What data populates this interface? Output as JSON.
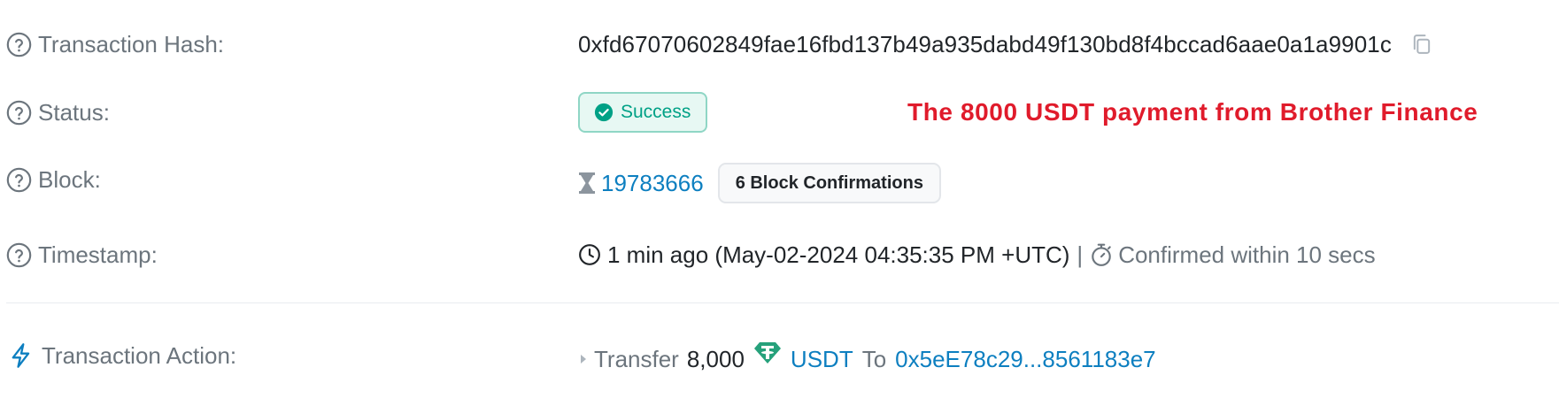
{
  "rows": {
    "tx_hash": {
      "label": "Transaction Hash:",
      "value": "0xfd67070602849fae16fbd137b49a935dabd49f130bd8f4bccad6aae0a1a9901c"
    },
    "status": {
      "label": "Status:",
      "badge": "Success",
      "note": "The 8000 USDT payment from Brother Finance"
    },
    "block": {
      "label": "Block:",
      "number": "19783666",
      "confirmations": "6 Block Confirmations"
    },
    "timestamp": {
      "label": "Timestamp:",
      "value": "1 min ago (May-02-2024 04:35:35 PM +UTC)",
      "separator": "|",
      "confirmed": "Confirmed within 10 secs"
    },
    "action": {
      "label": "Transaction Action:",
      "verb": "Transfer",
      "amount": "8,000",
      "token": "USDT",
      "to_word": "To",
      "to_address": "0x5eE78c29...8561183e7"
    }
  },
  "icons": {
    "help": "question-circle-icon",
    "copy": "copy-icon",
    "success": "check-circle-icon",
    "hourglass": "hourglass-icon",
    "clock": "clock-icon",
    "stopwatch": "stopwatch-icon",
    "lightning": "lightning-icon",
    "caret": "caret-right-icon",
    "token": "tether-token-icon"
  },
  "colors": {
    "link": "#0d7fc0",
    "success": "#00a186",
    "note": "#e01b2b",
    "muted": "#6c757d",
    "token": "#26a17b"
  }
}
